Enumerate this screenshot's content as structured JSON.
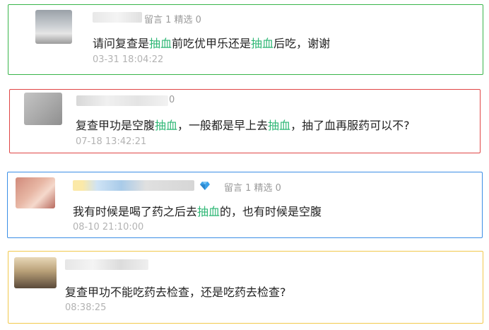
{
  "comments": [
    {
      "meta": "留言 1 精选 0",
      "segments": [
        "请问复查是",
        "抽血",
        "前吃优甲乐还是",
        "抽血",
        "后吃，谢谢"
      ],
      "time": "03-31 18:04:22",
      "border_color": "#39b54a"
    },
    {
      "meta": "0",
      "segments": [
        "复查甲功是空腹",
        "抽血",
        "，一般都是早上去",
        "抽血",
        "，抽了血再服药可以不?"
      ],
      "time": "07-18 13:42:21",
      "border_color": "#e04545"
    },
    {
      "meta": "留言 1 精选 0",
      "badge_icon": "diamond-icon",
      "segments": [
        "我有时候是喝了药之后去",
        "抽血",
        "的，也有时候是空腹"
      ],
      "time": "08-10 21:10:00",
      "border_color": "#3a8ee6"
    },
    {
      "segments": [
        "复查甲功不能吃药去检查，还是吃药去检查?"
      ],
      "time": "08:38:25",
      "border_color": "#f2c94c"
    }
  ],
  "highlight_color": "#2bb673"
}
